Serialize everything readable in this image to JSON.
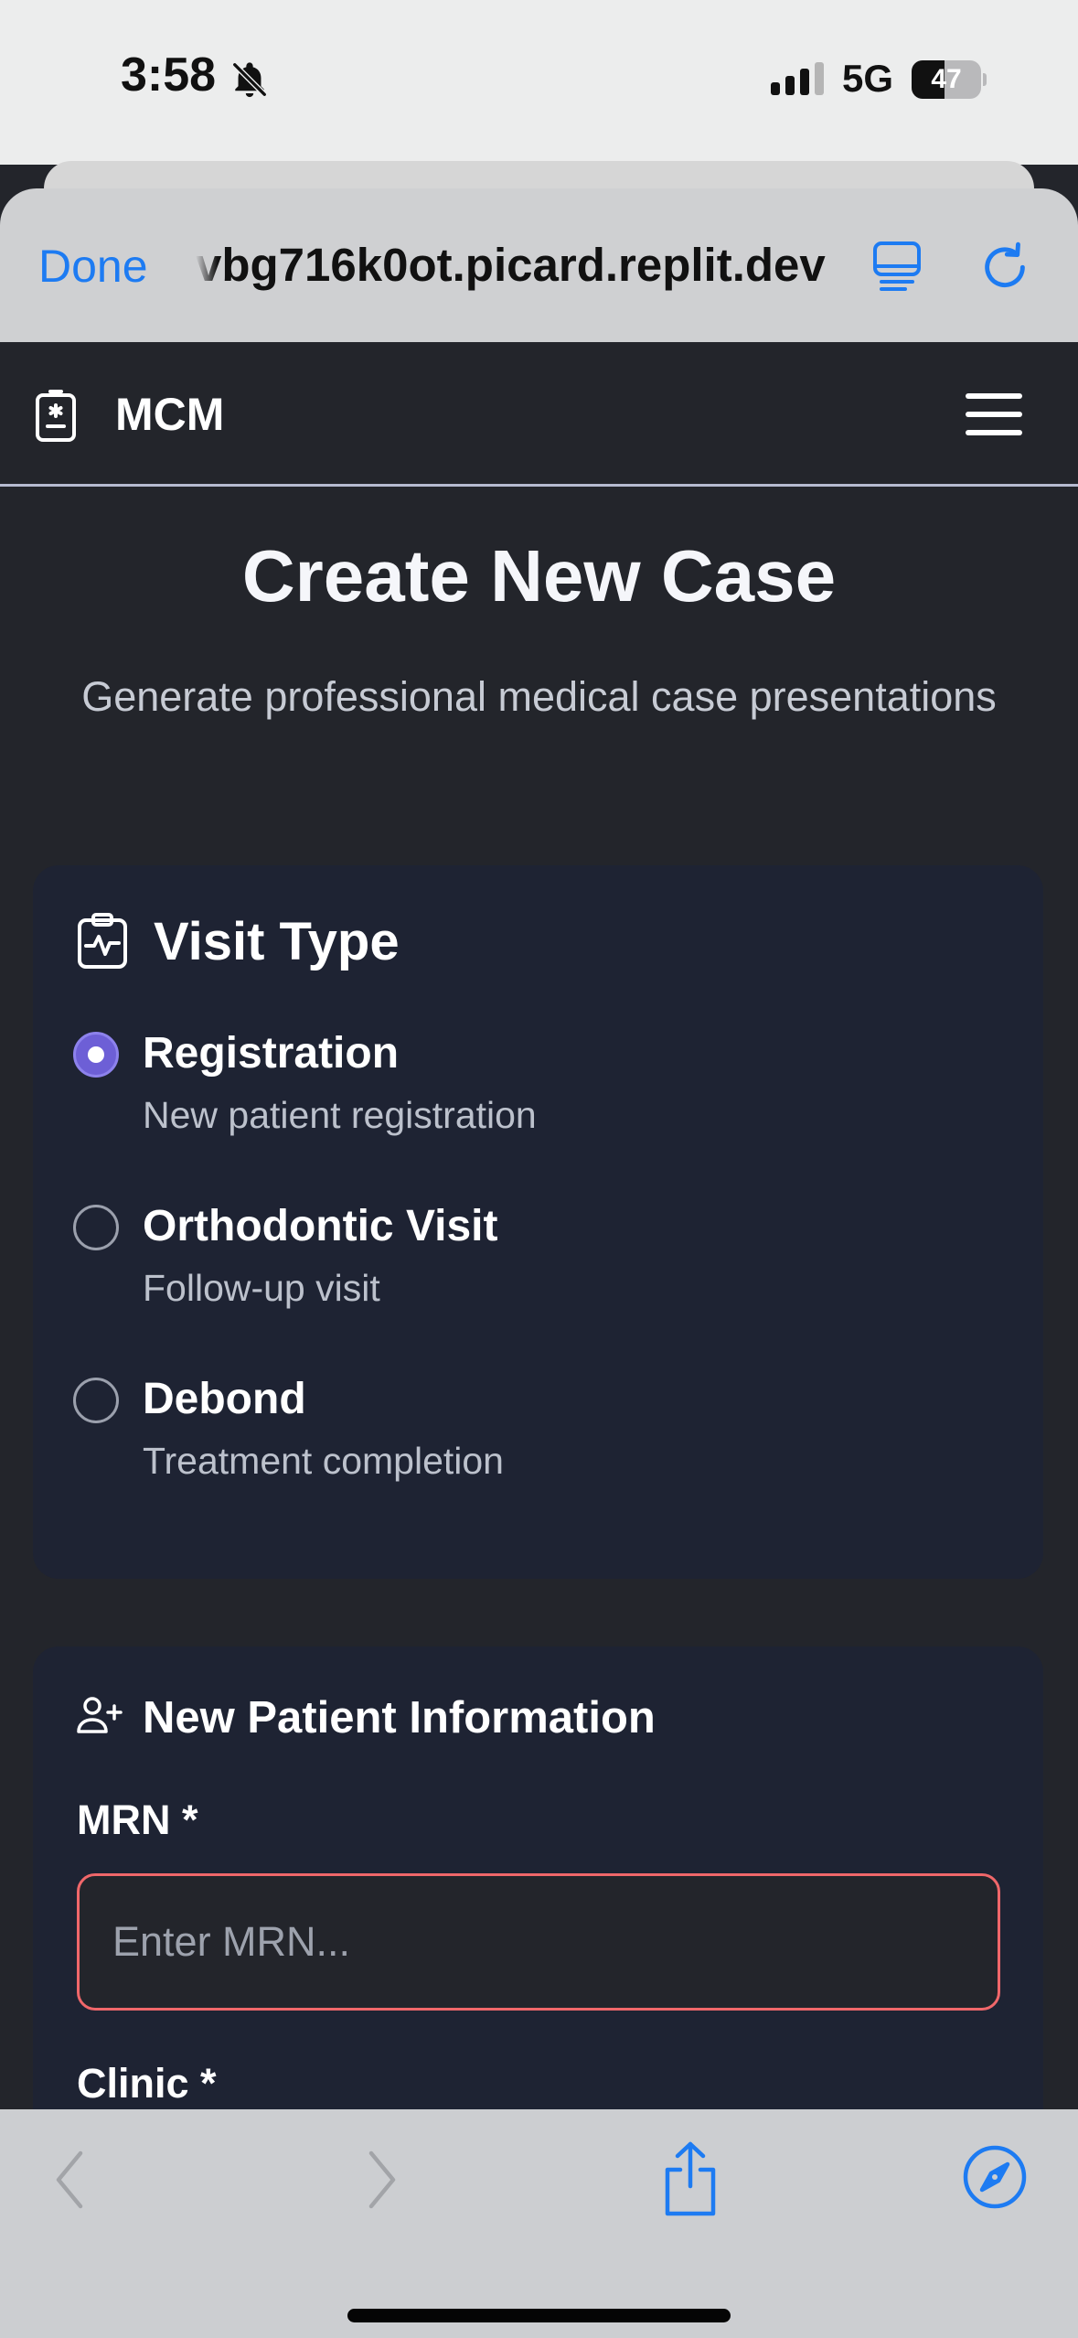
{
  "status_bar": {
    "time": "3:58",
    "network": "5G",
    "battery_percent": "47",
    "battery_level": 0.47
  },
  "browser": {
    "done_label": "Done",
    "url": "vbg716k0ot.picard.replit.dev"
  },
  "app": {
    "brand": "MCM"
  },
  "page": {
    "title": "Create New Case",
    "subtitle": "Generate professional medical case presentations"
  },
  "visit_type": {
    "title": "Visit Type",
    "options": [
      {
        "label": "Registration",
        "description": "New patient registration",
        "selected": true
      },
      {
        "label": "Orthodontic Visit",
        "description": "Follow-up visit",
        "selected": false
      },
      {
        "label": "Debond",
        "description": "Treatment completion",
        "selected": false
      }
    ]
  },
  "patient": {
    "title": "New Patient Information",
    "mrn_label": "MRN *",
    "mrn_placeholder": "Enter MRN...",
    "mrn_value": "",
    "clinic_label": "Clinic *"
  },
  "colors": {
    "accent": "#6d5fd6",
    "ios_blue": "#1d7bf2",
    "error_border": "#f0676a",
    "card_bg": "#1e2333",
    "page_bg": "#23252b"
  }
}
